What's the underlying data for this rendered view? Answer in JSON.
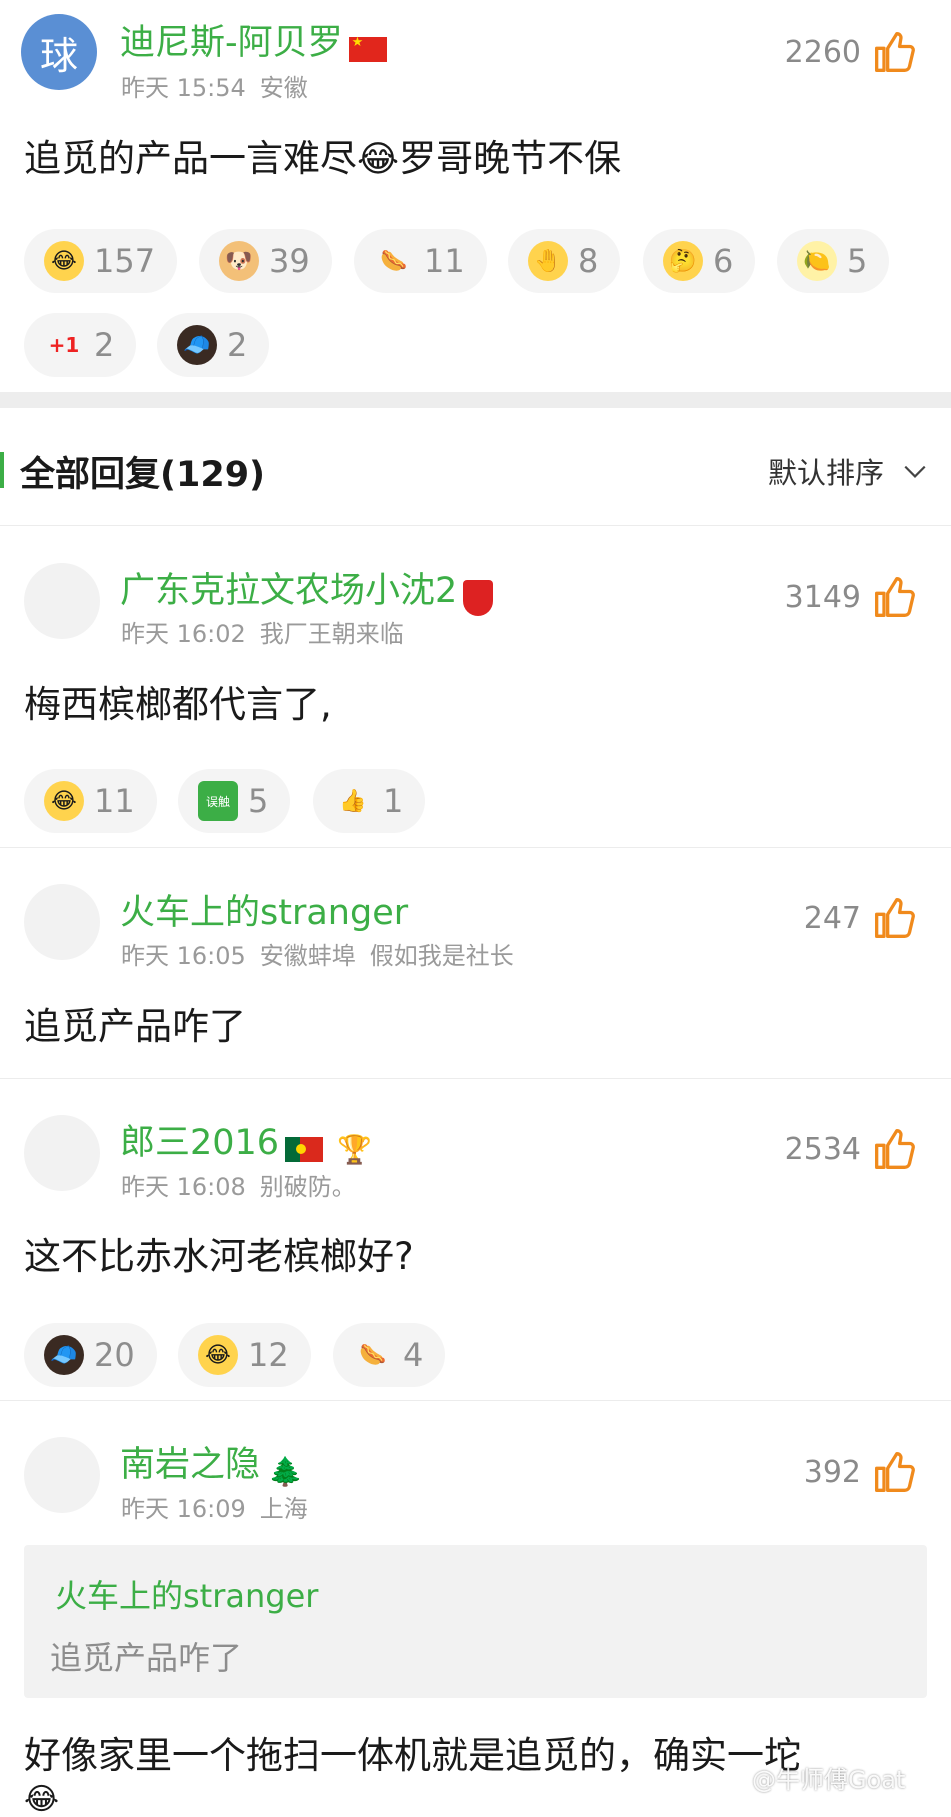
{
  "main_comment": {
    "avatar_char": "球",
    "username": "迪尼斯-阿贝罗",
    "time": "昨天 15:54",
    "location": "安徽",
    "likes": "2260",
    "text_a": "追觅的产品一言难尽",
    "text_b": "罗哥晚节不保",
    "reactions": [
      {
        "icon": "laugh-cry-icon",
        "glyph": "😂",
        "count": "157"
      },
      {
        "icon": "doge-icon",
        "glyph": "🐶",
        "count": "39"
      },
      {
        "icon": "sausage-icon",
        "glyph": "🌭",
        "count": "11"
      },
      {
        "icon": "slap-face-icon",
        "glyph": "🤚",
        "count": "8"
      },
      {
        "icon": "thinking-icon",
        "glyph": "🤔",
        "count": "6"
      },
      {
        "icon": "lemon-icon",
        "glyph": "🍋",
        "count": "5"
      },
      {
        "icon": "plus-one-icon",
        "glyph": "+1",
        "count": "2"
      },
      {
        "icon": "man-face-icon",
        "glyph": "🧢",
        "count": "2"
      }
    ]
  },
  "replies_header": {
    "title": "全部回复(129)",
    "sort_label": "默认排序"
  },
  "replies": [
    {
      "username": "广东克拉文农场小沈2",
      "time": "昨天 16:02",
      "location": "我厂王朝来临",
      "likes": "3149",
      "text": "梅西槟榔都代言了,",
      "reactions": [
        {
          "icon": "laugh-cry-icon",
          "glyph": "😂",
          "count": "11"
        },
        {
          "icon": "misclick-icon",
          "glyph": "误触",
          "count": "5"
        },
        {
          "icon": "thumbs-up-icon",
          "glyph": "👍",
          "count": "1"
        }
      ]
    },
    {
      "username": "火车上的stranger",
      "time": "昨天 16:05",
      "location": "安徽蚌埠",
      "extra": "假如我是社长",
      "likes": "247",
      "text": "追觅产品咋了"
    },
    {
      "username": "郎三2016",
      "time": "昨天 16:08",
      "location": "别破防。",
      "likes": "2534",
      "text": "这不比赤水河老槟榔好?",
      "reactions": [
        {
          "icon": "man-face-icon",
          "glyph": "🧢",
          "count": "20"
        },
        {
          "icon": "laugh-cry-icon",
          "glyph": "😂",
          "count": "12"
        },
        {
          "icon": "sausage-icon",
          "glyph": "🌭",
          "count": "4"
        }
      ]
    },
    {
      "username": "南岩之隐",
      "time": "昨天 16:09",
      "location": "上海",
      "likes": "392",
      "quote_user": "火车上的stranger",
      "quote_text": "追觅产品咋了",
      "text": "好像家里一个拖扫一体机就是追觅的，确实一坨"
    }
  ],
  "watermark": "@牛师傅Goat",
  "colors": {
    "username": "#3cae46",
    "thumb": "#f08a1c",
    "meta": "#9a9a9a"
  }
}
